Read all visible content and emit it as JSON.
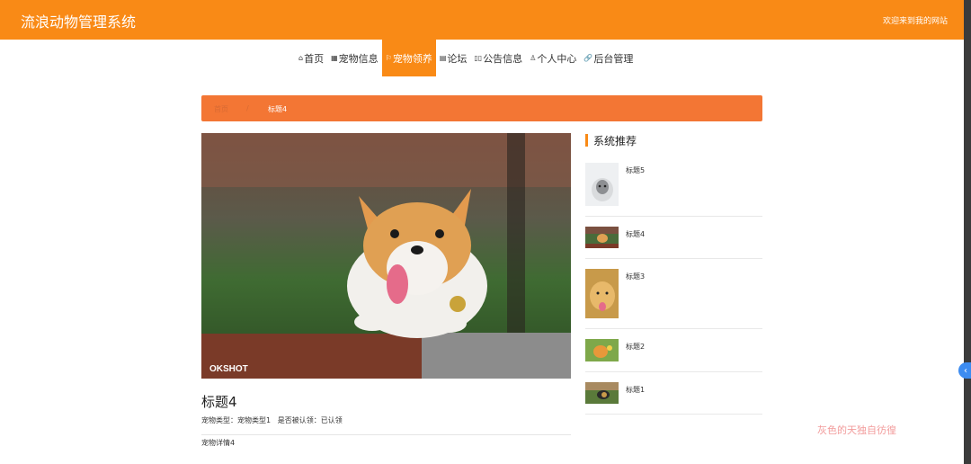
{
  "header": {
    "title": "流浪动物管理系统",
    "welcome": "欢迎来到我的网站"
  },
  "nav": [
    {
      "icon": "⌂",
      "label": "首页"
    },
    {
      "icon": "▦",
      "label": "宠物信息"
    },
    {
      "icon": "⚐",
      "label": "宠物领养"
    },
    {
      "icon": "▤",
      "label": "论坛"
    },
    {
      "icon": "▯▯",
      "label": "公告信息"
    },
    {
      "icon": "♙",
      "label": "个人中心"
    },
    {
      "icon": "🔗",
      "label": "后台管理"
    }
  ],
  "breadcrumb": {
    "home": "首页",
    "sep": "/",
    "current": "标题4"
  },
  "detail": {
    "title": "标题4",
    "type_label": "宠物类型：",
    "type_value": "宠物类型1",
    "adopted_label": "是否被认领：",
    "adopted_value": "已认领",
    "description": "宠物详情4",
    "photo_caption": "OKSHOT"
  },
  "recommend": {
    "title": "系统推荐",
    "items": [
      {
        "label": "标题5"
      },
      {
        "label": "标题4"
      },
      {
        "label": "标题3"
      },
      {
        "label": "标题2"
      },
      {
        "label": "标题1"
      }
    ]
  },
  "watermark": "灰色的天独自彷徨",
  "colors": {
    "accent": "#f98a16",
    "breadcrumb": "#f37634"
  }
}
